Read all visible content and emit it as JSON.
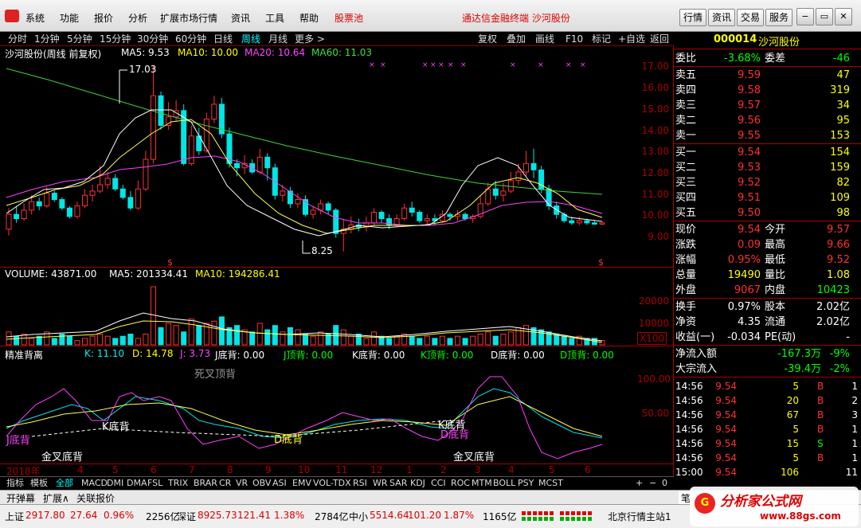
{
  "menu": {
    "items": [
      "系统",
      "功能",
      "报价",
      "分析",
      "扩展市场行情",
      "资讯",
      "工具",
      "帮助"
    ],
    "stock_pool": "股票池",
    "brand": "通达信金融终端  沙河股份",
    "buttons": [
      "行情",
      "资讯",
      "交易",
      "服务"
    ]
  },
  "periods": {
    "items": [
      "分时",
      "1分钟",
      "5分钟",
      "15分钟",
      "30分钟",
      "60分钟",
      "日线",
      "周线",
      "月线",
      "更多 >"
    ],
    "active": "周线"
  },
  "tools": [
    "复权",
    "叠加",
    "画线",
    "F10",
    "标记",
    "+自选",
    "返回"
  ],
  "main_chart": {
    "title": "沙河股份(周线 前复权)",
    "ma5": "MA5: 9.53",
    "ma10": "MA10: 10.00",
    "ma20": "MA20: 10.64",
    "ma60": "MA60: 11.03",
    "high_label": "17.03",
    "low_label": "8.25",
    "y_ticks": [
      "17.00",
      "16.00",
      "15.00",
      "14.00",
      "13.00",
      "12.00",
      "11.00",
      "10.00",
      "9.00"
    ]
  },
  "volume": {
    "title": "VOLUME: 43871.00",
    "ma5": "MA5: 201334.41",
    "ma10": "MA10: 194286.41",
    "ticks": [
      "20000",
      "10000"
    ],
    "unit": "X100"
  },
  "indicator": {
    "name": "精准背离",
    "k": "K: 11.10",
    "d": "D: 14.78",
    "j": "J: 3.73",
    "j_bottom": "J底背: 0.00",
    "j_top": "J顶背: 0.00",
    "k_bottom": "K底背: 0.00",
    "k_top": "K顶背: 0.00",
    "d_bottom": "D底背: 0.00",
    "d_top": "D顶背: 0.00",
    "ticks": [
      "100.00",
      "50.00"
    ],
    "annotations": {
      "dead_cross": "死叉顶背",
      "k_bottom": "K底背",
      "d_bottom": "D底背",
      "k_bottom2": "K底背",
      "d_bottom2": "D底背",
      "j_bottom": "J底背",
      "golden1": "金叉底背",
      "golden2": "金叉底背"
    },
    "x_labels": [
      "2018年",
      "4",
      "5",
      "6",
      "7",
      "8",
      "9",
      "10",
      "11",
      "12",
      "1",
      "2",
      "3",
      "4",
      "5",
      "6"
    ]
  },
  "bottom_tabs": [
    "指标",
    "模板",
    "全部",
    "MACD",
    "DMI",
    "DMA",
    "FSL",
    "TRIX",
    "BRAR",
    "CR",
    "VR",
    "OBV",
    "ASI",
    "EMV",
    "VOL-TDX",
    "RSI",
    "WR",
    "SAR",
    "KDJ",
    "CCI",
    "ROC",
    "MTM",
    "BOLL",
    "PSY",
    "MCST"
  ],
  "sub_tabs": [
    "开弹幕",
    "扩展∧",
    "关联报价"
  ],
  "stock": {
    "code": "000014",
    "name": "沙河股份"
  },
  "quote": {
    "weibi": {
      "label": "委比",
      "value": "-3.68%",
      "label2": "委差",
      "value2": "-46"
    },
    "asks": [
      {
        "label": "卖五",
        "price": "9.59",
        "vol": "47"
      },
      {
        "label": "卖四",
        "price": "9.58",
        "vol": "319"
      },
      {
        "label": "卖三",
        "price": "9.57",
        "vol": "34"
      },
      {
        "label": "卖二",
        "price": "9.56",
        "vol": "95"
      },
      {
        "label": "卖一",
        "price": "9.55",
        "vol": "153"
      }
    ],
    "bids": [
      {
        "label": "买一",
        "price": "9.54",
        "vol": "154"
      },
      {
        "label": "买二",
        "price": "9.53",
        "vol": "159"
      },
      {
        "label": "买三",
        "price": "9.52",
        "vol": "82"
      },
      {
        "label": "买四",
        "price": "9.51",
        "vol": "109"
      },
      {
        "label": "买五",
        "price": "9.50",
        "vol": "98"
      }
    ],
    "stats": [
      {
        "l1": "现价",
        "v1": "9.54",
        "l2": "今开",
        "v2": "9.57"
      },
      {
        "l1": "涨跌",
        "v1": "0.09",
        "l2": "最高",
        "v2": "9.66"
      },
      {
        "l1": "涨幅",
        "v1": "0.95%",
        "l2": "最低",
        "v2": "9.52"
      },
      {
        "l1": "总量",
        "v1": "19490",
        "l2": "量比",
        "v2": "1.08"
      },
      {
        "l1": "外盘",
        "v1": "9067",
        "l2": "内盘",
        "v2": "10423"
      }
    ],
    "stats2": [
      {
        "l1": "换手",
        "v1": "0.97%",
        "l2": "股本",
        "v2": "2.02亿"
      },
      {
        "l1": "净资",
        "v1": "4.35",
        "l2": "流通",
        "v2": "2.02亿"
      },
      {
        "l1": "收益(一)",
        "v1": "-0.034",
        "l2": "PE(动)",
        "v2": "-"
      }
    ],
    "flow": [
      {
        "label": "净流入额",
        "value": "-167.3万",
        "pct": "-9%"
      },
      {
        "label": "大宗流入",
        "value": "-39.4万",
        "pct": "-2%"
      }
    ],
    "ticks": [
      {
        "time": "14:56",
        "price": "9.54",
        "vol": "5",
        "side": "B",
        "n": "1"
      },
      {
        "time": "14:56",
        "price": "9.54",
        "vol": "20",
        "side": "B",
        "n": "2"
      },
      {
        "time": "14:56",
        "price": "9.54",
        "vol": "67",
        "side": "B",
        "n": "3"
      },
      {
        "time": "14:56",
        "price": "9.54",
        "vol": "5",
        "side": "B",
        "n": "1"
      },
      {
        "time": "14:56",
        "price": "9.54",
        "vol": "15",
        "side": "S",
        "n": "1"
      },
      {
        "time": "14:56",
        "price": "9.54",
        "vol": "5",
        "side": "B",
        "n": "1"
      },
      {
        "time": "15:00",
        "price": "9.54",
        "vol": "106",
        "side": "",
        "n": "11"
      }
    ]
  },
  "status": {
    "sh": "上证",
    "sh_val": "2917.80",
    "sh_chg": "27.64",
    "sh_pct": "0.96%",
    "sh_amt": "2256亿",
    "sz": "深证",
    "sz_val": "8925.73",
    "sz_chg": "121.41",
    "sz_pct": "1.38%",
    "sz_amt": "2784亿",
    "zx": "中小",
    "zx_val": "5514.64",
    "zx_chg": "101.20",
    "zx_pct": "1.87%",
    "zx_amt": "1165亿",
    "server": "北京行情主站1",
    "watermark": "分析家公式网",
    "watermark_url": "www.88gs.com",
    "panel_tab": "笔"
  },
  "colors": {
    "up": "#ff3030",
    "down": "#00e5e5",
    "ma5": "#ffffff",
    "ma10": "#ffff50",
    "ma20": "#ff40ff",
    "ma60": "#40d040",
    "frame": "#aa0000"
  }
}
